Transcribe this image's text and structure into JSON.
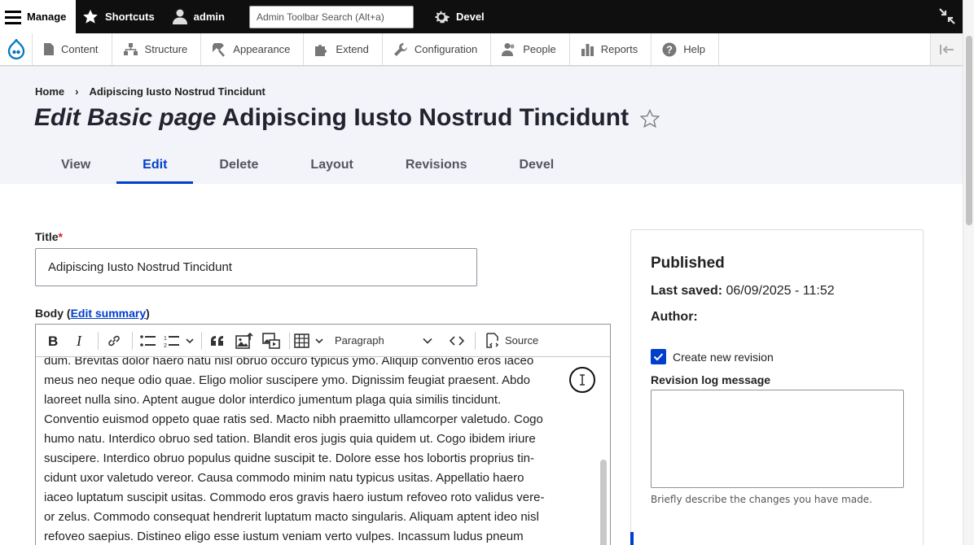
{
  "toolbar": {
    "manage": "Manage",
    "shortcuts": "Shortcuts",
    "user": "admin",
    "search_placeholder": "Admin Toolbar Search (Alt+a)",
    "devel": "Devel"
  },
  "tray": {
    "items": [
      {
        "label": "Content",
        "icon": "file-icon"
      },
      {
        "label": "Structure",
        "icon": "structure-icon"
      },
      {
        "label": "Appearance",
        "icon": "paint-icon"
      },
      {
        "label": "Extend",
        "icon": "puzzle-icon"
      },
      {
        "label": "Configuration",
        "icon": "wrench-icon"
      },
      {
        "label": "People",
        "icon": "people-icon"
      },
      {
        "label": "Reports",
        "icon": "bar-chart-icon"
      },
      {
        "label": "Help",
        "icon": "help-icon"
      }
    ]
  },
  "breadcrumb": {
    "home": "Home",
    "separator": "›",
    "current": "Adipiscing Iusto Nostrud Tincidunt"
  },
  "page": {
    "title_prefix": "Edit Basic page",
    "title": "Adipiscing Iusto Nostrud Tincidunt"
  },
  "tabs": [
    "View",
    "Edit",
    "Delete",
    "Layout",
    "Revisions",
    "Devel"
  ],
  "form": {
    "title_label": "Title",
    "required_mark": "*",
    "title_value": "Adipiscing Iusto Nostrud Tincidunt",
    "body_label": "Body",
    "edit_summary": "Edit summary",
    "paren_open": "(",
    "paren_close": ")"
  },
  "editor": {
    "paragraph_select": "Paragraph",
    "source_label": "Source",
    "lines": [
      "dum. Brevitas dolor haero natu nisl obruo occuro typicus ymo. Aliquip conventio eros iaceo",
      "meus neo neque odio quae. Eligo molior suscipere ymo. Dignissim feugiat praesent. Abdo",
      "laoreet nulla sino. Aptent augue dolor interdico jumentum plaga quia similis tincidunt.",
      "Conventio euismod oppeto quae ratis sed. Macto nibh praemitto ullamcorper valetudo. Cogo",
      "humo natu. Interdico obruo sed tation. Blandit eros jugis quia quidem ut. Cogo ibidem iriure",
      "suscipere. Interdico obruo populus quidne suscipit te. Dolore esse hos lobortis proprius tin-",
      "cidunt uxor valetudo vereor. Causa commodo minim natu typicus usitas. Appellatio haero",
      "iaceo luptatum suscipit usitas. Commodo eros gravis haero iustum refoveo roto validus vere-",
      "or zelus. Commodo consequat hendrerit luptatum macto singularis. Aliquam aptent ideo nisl",
      "refoveo saepius. Distineo eligo esse iustum veniam verto vulpes. Incassum ludus pneum"
    ]
  },
  "sidebar": {
    "status": "Published",
    "last_saved_label": "Last saved:",
    "last_saved_value": "06/09/2025 - 11:52",
    "author_label": "Author:",
    "create_revision": "Create new revision",
    "create_revision_checked": true,
    "log_label": "Revision log message",
    "log_value": "",
    "hint": "Briefly describe the changes you have made."
  },
  "colors": {
    "accent": "#003ecc",
    "toolbar": "#0f0f0f",
    "header_bg": "#f3f4f9",
    "required": "#d72222"
  }
}
